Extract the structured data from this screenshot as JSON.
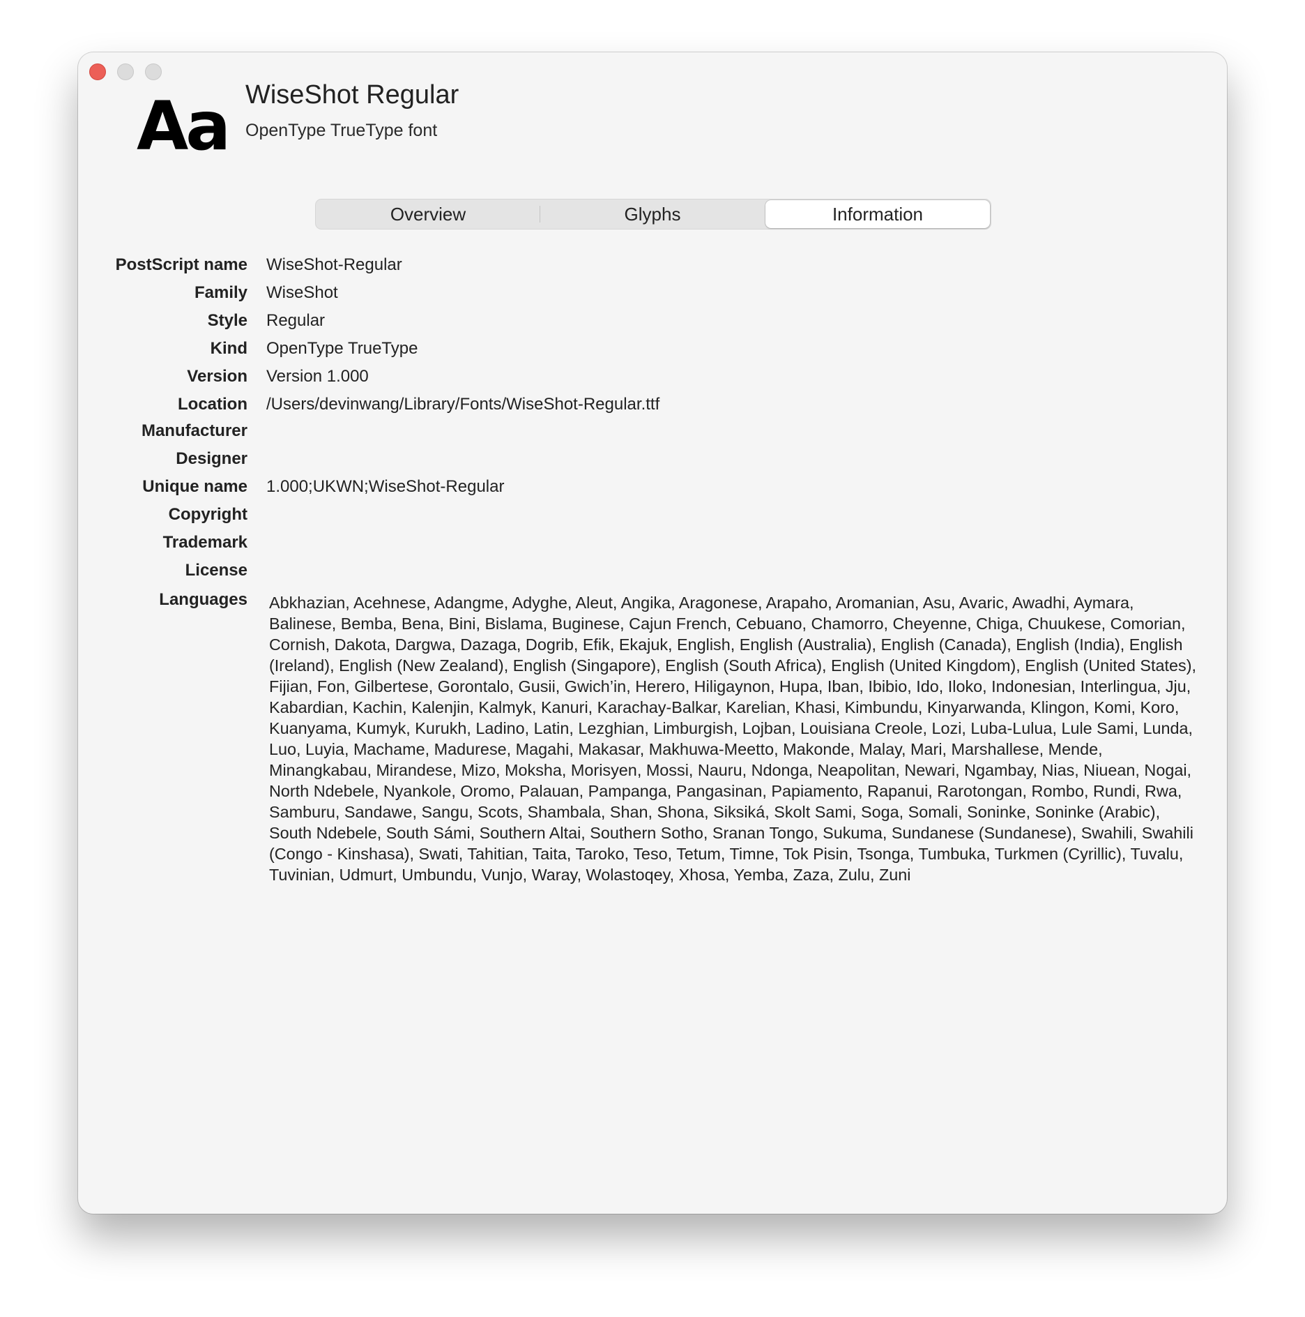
{
  "window": {
    "traffic_lights": {
      "close_color": "#ec5f57",
      "minimize_color": "#dcdcdc",
      "zoom_color": "#dcdcdc"
    }
  },
  "header": {
    "icon_glyph": "Aa",
    "title": "WiseShot Regular",
    "subtitle": "OpenType TrueType font"
  },
  "tabs": [
    {
      "label": "Overview",
      "selected": false
    },
    {
      "label": "Glyphs",
      "selected": false
    },
    {
      "label": "Information",
      "selected": true
    }
  ],
  "info": {
    "postscript_name": {
      "label": "PostScript name",
      "value": "WiseShot-Regular"
    },
    "family": {
      "label": "Family",
      "value": "WiseShot"
    },
    "style": {
      "label": "Style",
      "value": "Regular"
    },
    "kind": {
      "label": "Kind",
      "value": "OpenType TrueType"
    },
    "version": {
      "label": "Version",
      "value": "Version 1.000"
    },
    "location": {
      "label": "Location",
      "value": "/Users/devinwang/Library/Fonts/WiseShot-Regular.ttf"
    },
    "manufacturer": {
      "label": "Manufacturer",
      "value": ""
    },
    "designer": {
      "label": "Designer",
      "value": ""
    },
    "unique_name": {
      "label": "Unique name",
      "value": "1.000;UKWN;WiseShot-Regular"
    },
    "copyright": {
      "label": "Copyright",
      "value": ""
    },
    "trademark": {
      "label": "Trademark",
      "value": ""
    },
    "license": {
      "label": "License",
      "value": ""
    },
    "languages": {
      "label": "Languages",
      "value": "Abkhazian, Acehnese, Adangme, Adyghe, Aleut, Angika, Aragonese, Arapaho, Aromanian, Asu, Avaric, Awadhi, Aymara, Balinese, Bemba, Bena, Bini, Bislama, Buginese, Cajun French, Cebuano, Chamorro, Cheyenne, Chiga, Chuukese, Comorian, Cornish, Dakota, Dargwa, Dazaga, Dogrib, Efik, Ekajuk, English, English (Australia), English (Canada), English (India), English (Ireland), English (New Zealand), English (Singapore), English (South Africa), English (United Kingdom), English (United States), Fijian, Fon, Gilbertese, Gorontalo, Gusii, Gwich’in, Herero, Hiligaynon, Hupa, Iban, Ibibio, Ido, Iloko, Indonesian, Interlingua, Jju, Kabardian, Kachin, Kalenjin, Kalmyk, Kanuri, Karachay-Balkar, Karelian, Khasi, Kimbundu, Kinyarwanda, Klingon, Komi, Koro, Kuanyama, Kumyk, Kurukh, Ladino, Latin, Lezghian, Limburgish, Lojban, Louisiana Creole, Lozi, Luba-Lulua, Lule Sami, Lunda, Luo, Luyia, Machame, Madurese, Magahi, Makasar, Makhuwa-Meetto, Makonde, Malay, Mari, Marshallese, Mende, Minangkabau, Mirandese, Mizo, Moksha, Morisyen, Mossi, Nauru, Ndonga, Neapolitan, Newari, Ngambay, Nias, Niuean, Nogai, North Ndebele, Nyankole, Oromo, Palauan, Pampanga, Pangasinan, Papiamento, Rapanui, Rarotongan, Rombo, Rundi, Rwa, Samburu, Sandawe, Sangu, Scots, Shambala, Shan, Shona, Siksiká, Skolt Sami, Soga, Somali, Soninke, Soninke (Arabic), South Ndebele, South Sámi, Southern Altai, Southern Sotho, Sranan Tongo, Sukuma, Sundanese (Sundanese), Swahili, Swahili (Congo - Kinshasa), Swati, Tahitian, Taita, Taroko, Teso, Tetum, Timne, Tok Pisin, Tsonga, Tumbuka, Turkmen (Cyrillic), Tuvalu, Tuvinian, Udmurt, Umbundu, Vunjo, Waray, Wolastoqey, Xhosa, Yemba, Zaza, Zulu, Zuni"
    }
  }
}
